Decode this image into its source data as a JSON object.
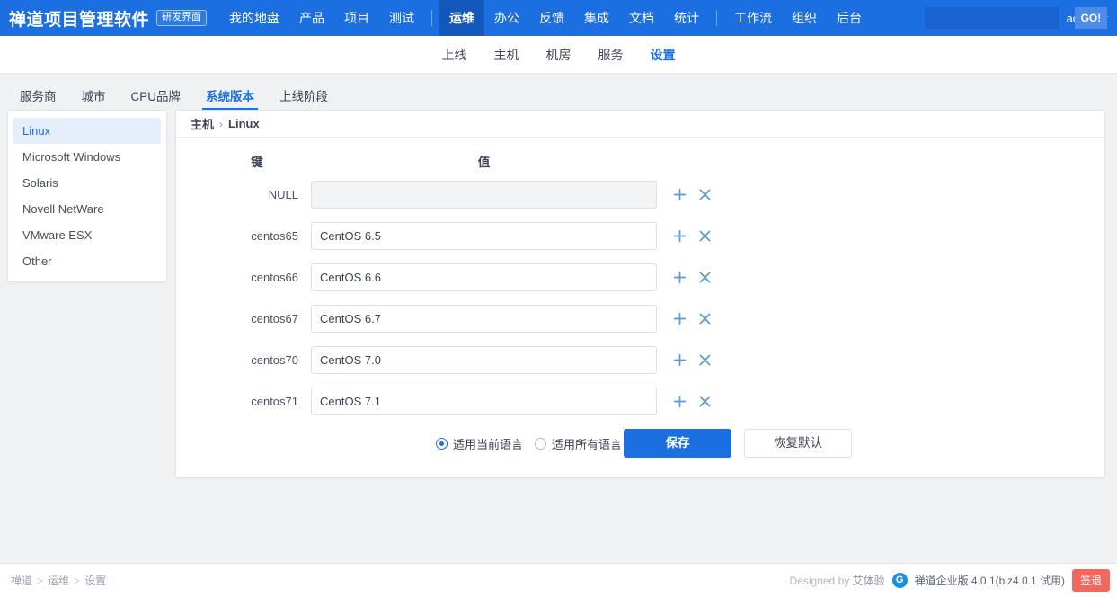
{
  "header": {
    "brand_title": "禅道项目管理软件",
    "brand_badge": "研发界面",
    "nav": [
      {
        "label": "我的地盘",
        "active": false
      },
      {
        "label": "产品",
        "active": false
      },
      {
        "label": "项目",
        "active": false
      },
      {
        "label": "测试",
        "active": false
      },
      {
        "label": "运维",
        "active": true
      },
      {
        "label": "办公",
        "active": false
      },
      {
        "label": "反馈",
        "active": false
      },
      {
        "label": "集成",
        "active": false
      },
      {
        "label": "文档",
        "active": false
      },
      {
        "label": "统计",
        "active": false
      },
      {
        "label": "工作流",
        "active": false
      },
      {
        "label": "组织",
        "active": false
      },
      {
        "label": "后台",
        "active": false
      }
    ],
    "search": {
      "value": "",
      "placeholder": "",
      "go_label": "GO!"
    },
    "account": "admin"
  },
  "subnav": {
    "items": [
      {
        "label": "上线",
        "active": false
      },
      {
        "label": "主机",
        "active": false
      },
      {
        "label": "机房",
        "active": false
      },
      {
        "label": "服务",
        "active": false
      },
      {
        "label": "设置",
        "active": true
      }
    ]
  },
  "tabs": [
    {
      "label": "服务商",
      "active": false
    },
    {
      "label": "城市",
      "active": false
    },
    {
      "label": "CPU品牌",
      "active": false
    },
    {
      "label": "系统版本",
      "active": true
    },
    {
      "label": "上线阶段",
      "active": false
    }
  ],
  "category_list": [
    {
      "label": "Linux",
      "active": true
    },
    {
      "label": "Microsoft Windows",
      "active": false
    },
    {
      "label": "Solaris",
      "active": false
    },
    {
      "label": "Novell NetWare",
      "active": false
    },
    {
      "label": "VMware ESX",
      "active": false
    },
    {
      "label": "Other",
      "active": false
    }
  ],
  "panel": {
    "breadcrumb_root": "主机",
    "breadcrumb_sep": "›",
    "breadcrumb_current": "Linux",
    "col_key_header": "键",
    "col_value_header": "值",
    "rows": [
      {
        "key": "NULL",
        "value": "",
        "readonly": true
      },
      {
        "key": "centos65",
        "value": "CentOS 6.5",
        "readonly": false
      },
      {
        "key": "centos66",
        "value": "CentOS 6.6",
        "readonly": false
      },
      {
        "key": "centos67",
        "value": "CentOS 6.7",
        "readonly": false
      },
      {
        "key": "centos70",
        "value": "CentOS 7.0",
        "readonly": false
      },
      {
        "key": "centos71",
        "value": "CentOS 7.1",
        "readonly": false
      }
    ],
    "radio_current_lang": "适用当前语言",
    "radio_all_lang": "适用所有语言",
    "radio_selected": "current",
    "save_label": "保存",
    "reset_label": "恢复默认",
    "add_icon": "plus-icon",
    "delete_icon": "close-icon"
  },
  "footer": {
    "crumb": [
      {
        "label": "禅道"
      },
      {
        "label": "运维"
      },
      {
        "label": "设置"
      }
    ],
    "crumb_sep": ">",
    "designed_by_prefix": "Designed by ",
    "designed_by_name": "艾体验",
    "logo_glyph": "G",
    "version": "禅道企业版 4.0.1(biz4.0.1 试用)",
    "logout_label": "签退"
  },
  "colors": {
    "brand_blue": "#1B6FE0",
    "active_nav_blue": "#1458BC",
    "icon_blue": "#5a9ada",
    "logout_red": "#f2675e",
    "page_bg": "#f0f1f3"
  }
}
